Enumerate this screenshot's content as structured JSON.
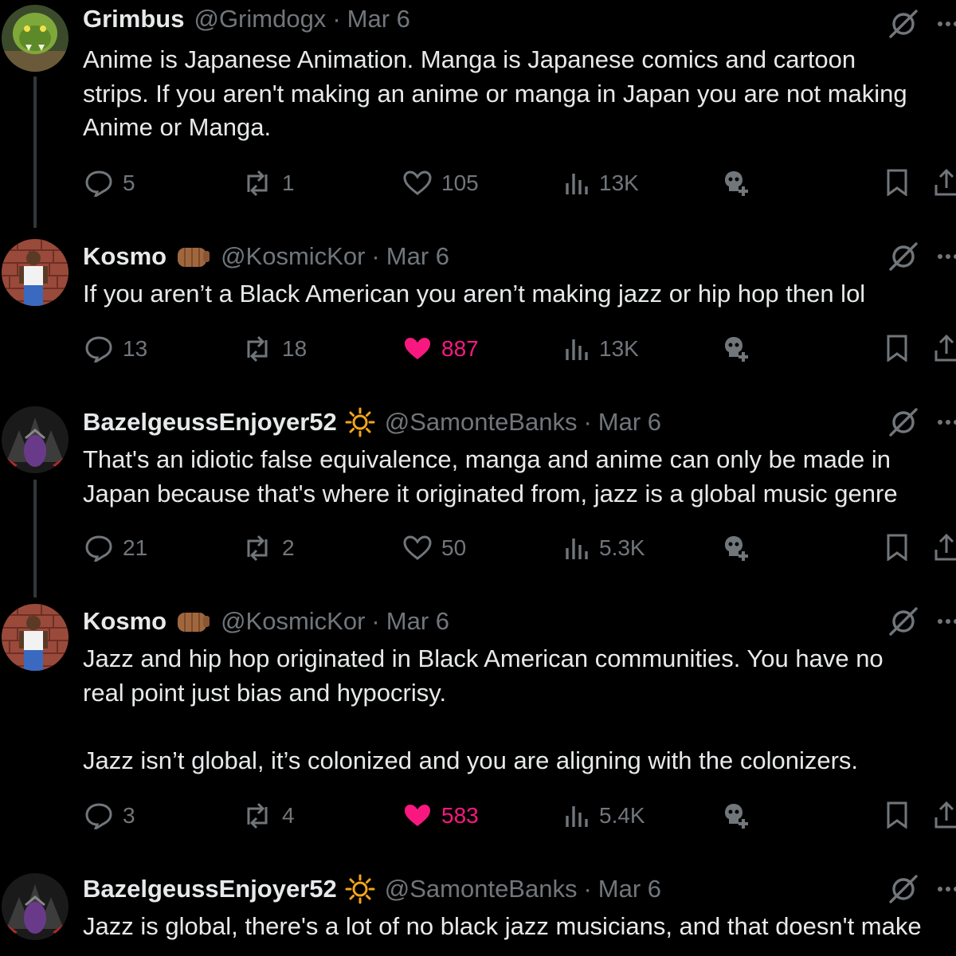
{
  "colors": {
    "background": "#000000",
    "text": "#e7e9ea",
    "muted": "#71767b",
    "like": "#f91880",
    "thread_line": "#333639"
  },
  "tweets": [
    {
      "name": "Grimbus",
      "handle": "@Grimdogx",
      "sep": "·",
      "date": "Mar 6",
      "badge": "",
      "text": "Anime is Japanese Animation. Manga is Japanese comics and cartoon\nstrips. If you aren't making an anime or manga in Japan you are not making\nAnime or Manga.",
      "replies": "5",
      "reposts": "1",
      "likes": "105",
      "views": "13K",
      "liked": false,
      "avatar_icon": "orc-avatar"
    },
    {
      "name": "Kosmo",
      "handle": "@KosmicKor",
      "sep": "·",
      "date": "Mar 6",
      "badge": "fist-emoji",
      "text": "If you aren’t a Black American you aren’t making jazz or hip hop then lol",
      "replies": "13",
      "reposts": "18",
      "likes": "887",
      "views": "13K",
      "liked": true,
      "avatar_icon": "pixel-man-avatar"
    },
    {
      "name": "BazelgeussEnjoyer52",
      "handle": "@SamonteBanks",
      "sep": "·",
      "date": "Mar 6",
      "badge": "sun-emoji",
      "text": "That's an idiotic false equivalence, manga and anime can only be made in\nJapan because that's where it originated from, jazz is a global music genre",
      "replies": "21",
      "reposts": "2",
      "likes": "50",
      "views": "5.3K",
      "liked": false,
      "avatar_icon": "dragon-avatar"
    },
    {
      "name": "Kosmo",
      "handle": "@KosmicKor",
      "sep": "·",
      "date": "Mar 6",
      "badge": "fist-emoji",
      "text": "Jazz and hip hop originated in Black American communities. You have no\nreal point just bias and hypocrisy.\n\nJazz isn’t global, it’s colonized and you are aligning with the colonizers.",
      "replies": "3",
      "reposts": "4",
      "likes": "583",
      "views": "5.4K",
      "liked": true,
      "avatar_icon": "pixel-man-avatar"
    },
    {
      "name": "BazelgeussEnjoyer52",
      "handle": "@SamonteBanks",
      "sep": "·",
      "date": "Mar 6",
      "badge": "sun-emoji",
      "text": "Jazz is global, there's a lot of no black jazz musicians, and that doesn't make",
      "avatar_icon": "dragon-avatar"
    }
  ]
}
